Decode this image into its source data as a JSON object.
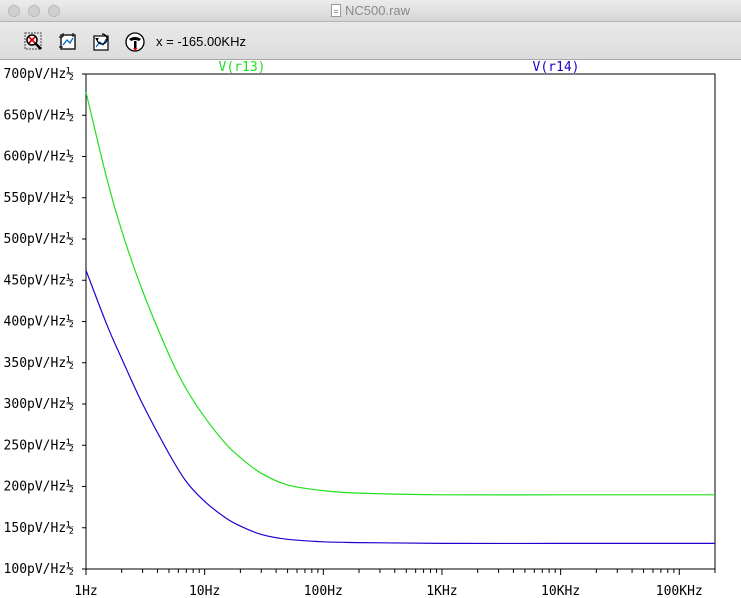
{
  "window": {
    "title": "NC500.raw"
  },
  "toolbar": {
    "buttons": [
      {
        "name": "zoom-cancel-button",
        "icon": "zoom-cancel-icon"
      },
      {
        "name": "autorange-button",
        "icon": "autorange-icon"
      },
      {
        "name": "undo-zoom-button",
        "icon": "undo-zoom-icon"
      },
      {
        "name": "cursor-probe-button",
        "icon": "probe-icon"
      }
    ],
    "cursor_readout": "x = -165.00KHz"
  },
  "colors": {
    "r13": "#22e022",
    "r14": "#2200cc",
    "axis": "#000000"
  },
  "chart_data": {
    "type": "line",
    "x_scale": "log",
    "xlim": [
      1,
      200000
    ],
    "ylim": [
      100,
      700
    ],
    "xticks": [
      1,
      10,
      100,
      1000,
      10000,
      100000
    ],
    "xtick_labels": [
      "1Hz",
      "10Hz",
      "100Hz",
      "1KHz",
      "10KHz",
      "100KHz"
    ],
    "yticks": [
      100,
      150,
      200,
      250,
      300,
      350,
      400,
      450,
      500,
      550,
      600,
      650,
      700
    ],
    "ytick_labels": [
      "100pV/Hz½",
      "150pV/Hz½",
      "200pV/Hz½",
      "250pV/Hz½",
      "300pV/Hz½",
      "350pV/Hz½",
      "400pV/Hz½",
      "450pV/Hz½",
      "500pV/Hz½",
      "550pV/Hz½",
      "600pV/Hz½",
      "650pV/Hz½",
      "700pV/Hz½"
    ],
    "series": [
      {
        "name": "V(r13)",
        "color": "#22e022",
        "x": [
          1,
          1.5,
          2,
          3,
          5,
          7,
          10,
          15,
          20,
          30,
          50,
          100,
          200,
          1000,
          10000,
          100000,
          200000
        ],
        "y": [
          678,
          573,
          510,
          437,
          360,
          318,
          284,
          252,
          235,
          216,
          202,
          195,
          192,
          190,
          190,
          190,
          190
        ]
      },
      {
        "name": "V(r14)",
        "color": "#2200cc",
        "x": [
          1,
          1.5,
          2,
          3,
          5,
          7,
          10,
          15,
          20,
          30,
          50,
          100,
          200,
          1000,
          10000,
          100000,
          200000
        ],
        "y": [
          462,
          396,
          355,
          300,
          240,
          206,
          182,
          162,
          152,
          142,
          136,
          133,
          132,
          131,
          131,
          131,
          131
        ]
      }
    ]
  }
}
